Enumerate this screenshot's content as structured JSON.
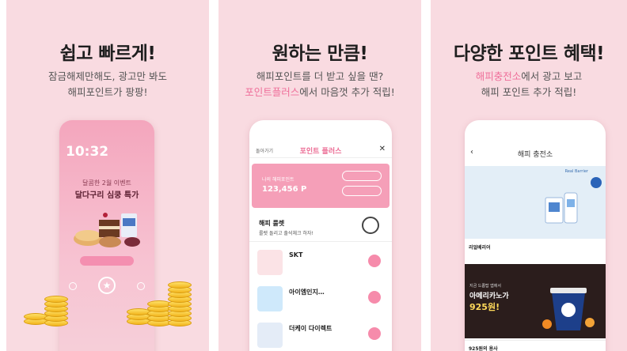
{
  "panels": [
    {
      "headline": "쉽고 빠르게!",
      "sub1": "잠금해제만해도, 광고만 봐도",
      "sub2": "해피포인트가 팡팡!",
      "lock_time": "10:32",
      "lock_date": "",
      "promo_line1": "달콤한 2월 이벤트",
      "promo_line2": "달다구리 심쿵 특가",
      "lock_button": "",
      "star_icon": "★"
    },
    {
      "headline": "원하는 만큼!",
      "sub1": "해피포인트를 더 받고 싶을 땐?",
      "sub2_highlight": "포인트플러스",
      "sub2_rest": "에서 마음껏 추가 적립!",
      "screen_title": "포인트 플러스",
      "back_label": "돌아가기",
      "close_icon": "✕",
      "card_label": "나의 해피포인트",
      "card_value": "123,456 P",
      "pill1": "",
      "pill2": "",
      "roulette_title": "해피 룰렛",
      "roulette_sub": "룰렛 돌리고 출석체크 하자!",
      "offers": [
        {
          "name": "SKT",
          "desc": "",
          "go": ""
        },
        {
          "name": "아이엠인지…",
          "desc": "",
          "go": ""
        },
        {
          "name": "더케이 다이렉트",
          "desc": "",
          "go": ""
        }
      ]
    },
    {
      "headline": "다양한 포인트 혜택!",
      "sub1_highlight": "해피충전소",
      "sub1_rest": "에서 광고 보고",
      "sub2": "해피 포인트 추가 적립!",
      "screen_title": "해피 충전소",
      "back_icon": "‹",
      "ad1_brand": "Real Barrier",
      "ad1_tag": "",
      "ad1_line1": "",
      "ad1_line2": "",
      "ad1_line3": "",
      "row1_name": "리얼베리어",
      "row1_desc": "",
      "row1_go": "",
      "ad2_line1": "지금 드롭탑 앱에서",
      "ad2_line2": "아메리카노가",
      "ad2_line3": "925원!",
      "row2_name": "925원의 용사",
      "row2_go": ""
    }
  ],
  "colors": {
    "panel_bg": "#f9dbe1",
    "accent_pink": "#ef6f9a",
    "coin_gold": "#f2b51d"
  }
}
